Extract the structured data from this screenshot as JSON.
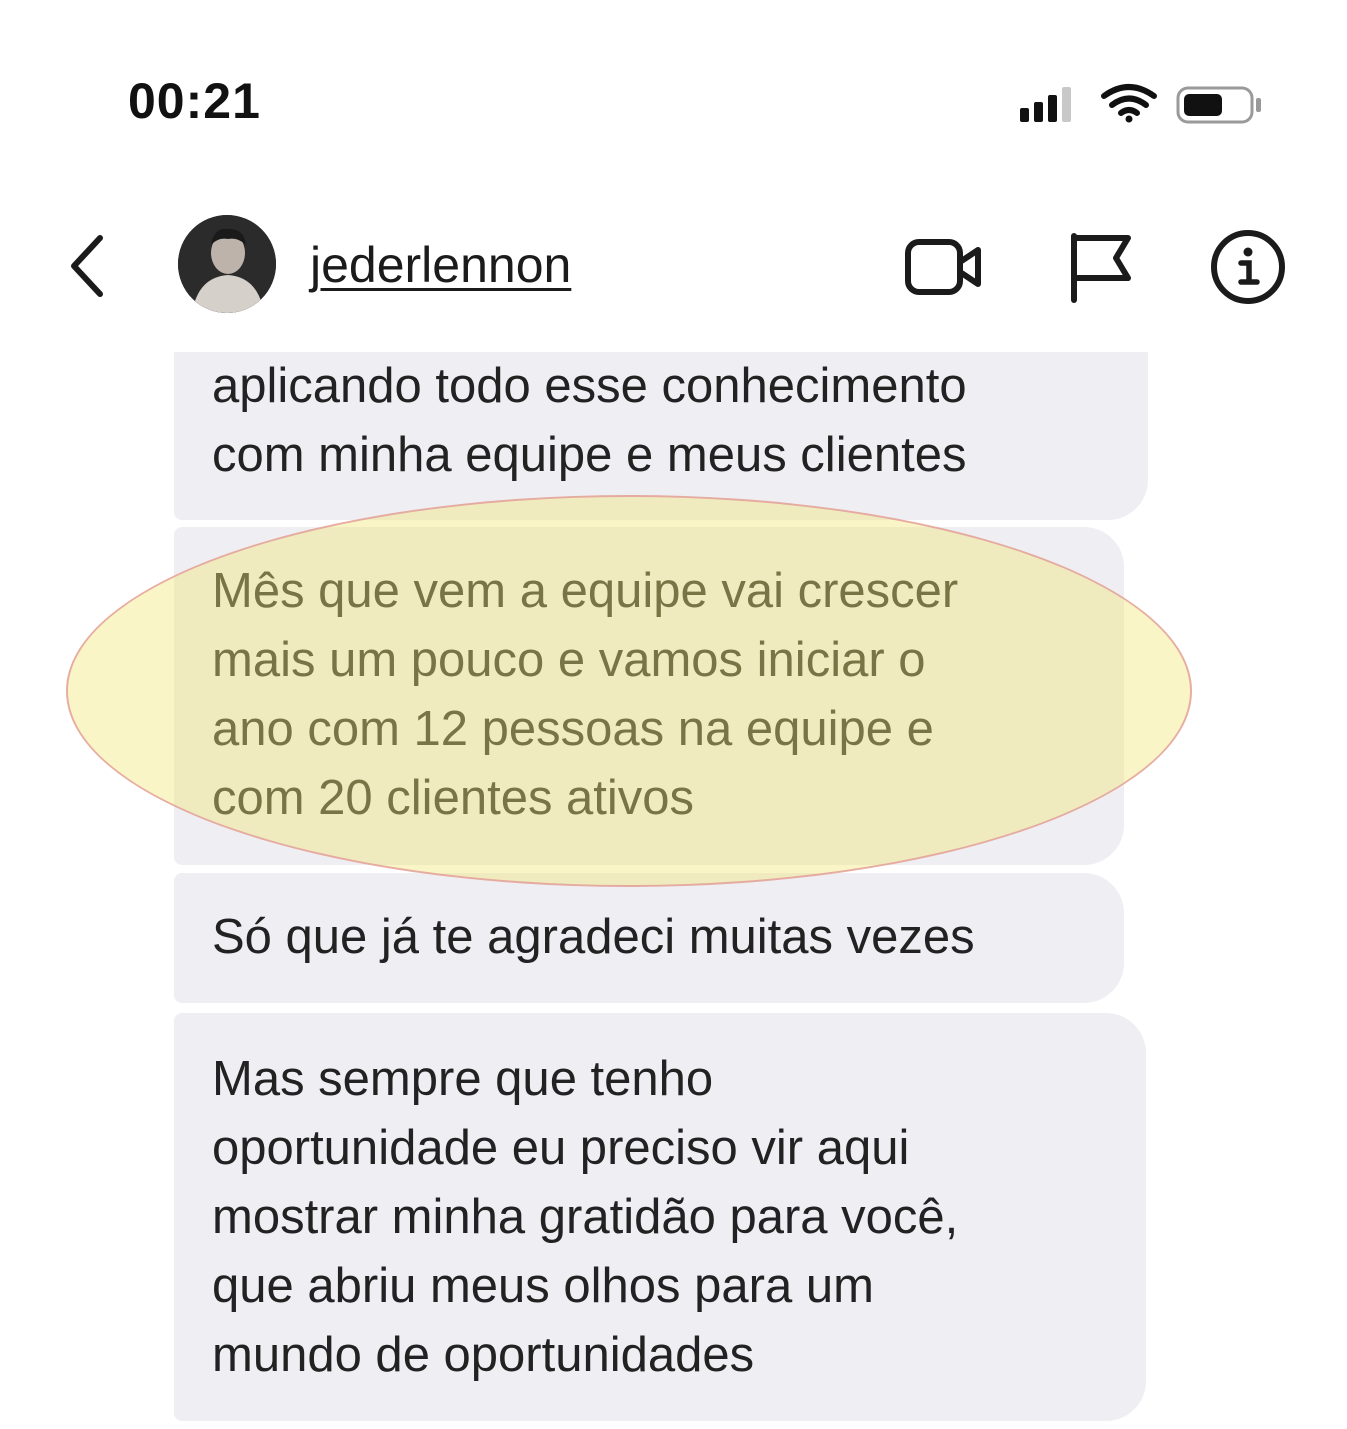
{
  "status_bar": {
    "time": "00:21"
  },
  "header": {
    "username": "jederlennon",
    "icons": {
      "back": "chevron-left-icon",
      "video": "video-camera-icon",
      "flag": "flag-icon",
      "info": "info-icon"
    }
  },
  "messages": [
    {
      "text": "aplicando todo esse conhecimento\ncom minha equipe e meus clientes"
    },
    {
      "text": "Mês que vem a equipe vai crescer\nmais um pouco e vamos iniciar o\nano com 12 pessoas na equipe e\ncom 20 clientes ativos"
    },
    {
      "text": "Só que já te agradeci muitas vezes"
    },
    {
      "text": "Mas sempre que tenho\noportunidade eu preciso vir aqui\nmostrar minha gratidão para você,\nque abriu meus olhos para um\nmundo de oportunidades"
    }
  ],
  "highlight": {
    "fill_color": "#f0e878",
    "stroke_color": "#e29696"
  },
  "colors": {
    "bubble": "#efeef3",
    "text": "#1b1b1b"
  }
}
